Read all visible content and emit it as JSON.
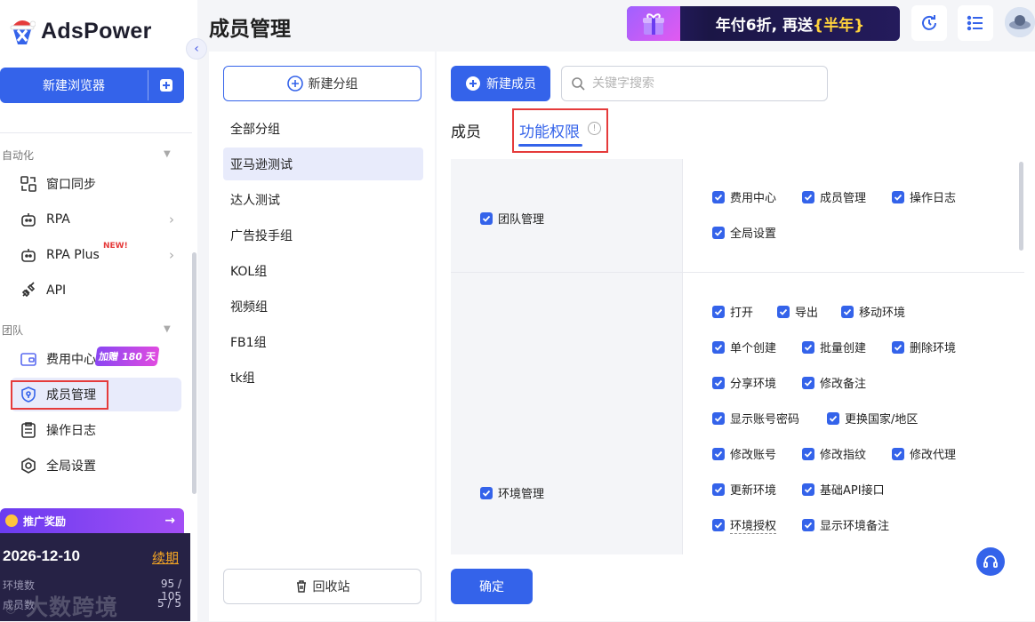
{
  "app": {
    "logo_text": "AdsPower"
  },
  "sidebar": {
    "new_browser": "新建浏览器",
    "sections": {
      "automation": "自动化",
      "team": "团队"
    },
    "items": [
      {
        "label": "窗口同步"
      },
      {
        "label": "RPA"
      },
      {
        "label": "RPA Plus",
        "badge": "NEW!"
      },
      {
        "label": "API"
      },
      {
        "label": "费用中心",
        "promo": "加赠 180 天"
      },
      {
        "label": "成员管理"
      },
      {
        "label": "操作日志"
      },
      {
        "label": "全局设置"
      }
    ],
    "promo_bar": "推广奖励",
    "expiry_date": "2026-12-10",
    "renew": "续期",
    "stats": [
      {
        "label": "环境数",
        "value": "95 / 105"
      },
      {
        "label": "成员数",
        "value": "5 / 5"
      }
    ],
    "watermark": "大数跨境"
  },
  "header": {
    "title": "成员管理",
    "banner": {
      "prefix": "年付6折, 再送",
      "highlight": "{半年}"
    }
  },
  "groups": {
    "new_group": "新建分组",
    "items": [
      "全部分组",
      "亚马逊测试",
      "达人测试",
      "广告投手组",
      "KOL组",
      "视频组",
      "FB1组",
      "tk组"
    ],
    "recycle": "回收站"
  },
  "main": {
    "new_member": "新建成员",
    "search_placeholder": "关键字搜索",
    "tabs": {
      "members": "成员",
      "permissions": "功能权限"
    },
    "perm_groups": [
      {
        "name": "团队管理",
        "perms": [
          "费用中心",
          "成员管理",
          "操作日志",
          "全局设置"
        ]
      },
      {
        "name": "环境管理",
        "perms": [
          "打开",
          "导出",
          "移动环境",
          "单个创建",
          "批量创建",
          "删除环境",
          "分享环境",
          "修改备注",
          "显示账号密码",
          "更换国家/地区",
          "修改账号",
          "修改指纹",
          "修改代理",
          "更新环境",
          "基础API接口",
          "环境授权",
          "显示环境备注"
        ]
      }
    ],
    "confirm": "确定"
  },
  "colors": {
    "primary": "#3463ea",
    "highlight_box": "#e53b3b"
  }
}
